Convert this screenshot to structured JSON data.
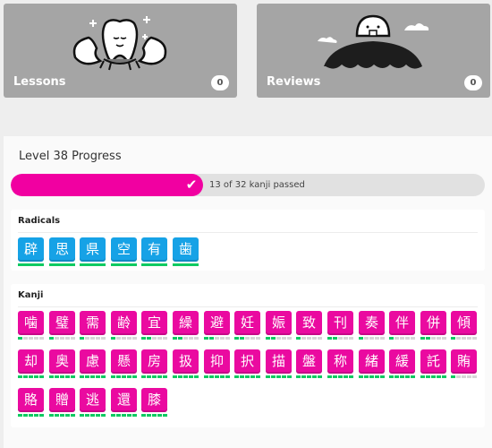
{
  "cards": {
    "lessons": {
      "label": "Lessons",
      "count": "0"
    },
    "reviews": {
      "label": "Reviews",
      "count": "0"
    }
  },
  "progress": {
    "title": "Level 38 Progress",
    "text": "13 of 32 kanji passed",
    "passed": 13,
    "total": 32,
    "fill_fraction": 0.405
  },
  "radicals": {
    "heading": "Radicals",
    "items": [
      "辟",
      "思",
      "県",
      "空",
      "有",
      "歯"
    ]
  },
  "kanji": {
    "heading": "Kanji",
    "items": [
      {
        "char": "噛",
        "stage": 1
      },
      {
        "char": "璧",
        "stage": 1
      },
      {
        "char": "需",
        "stage": 1
      },
      {
        "char": "齢",
        "stage": 1
      },
      {
        "char": "宜",
        "stage": 2
      },
      {
        "char": "繰",
        "stage": 2
      },
      {
        "char": "避",
        "stage": 2
      },
      {
        "char": "妊",
        "stage": 2
      },
      {
        "char": "娠",
        "stage": 2
      },
      {
        "char": "致",
        "stage": 1
      },
      {
        "char": "刊",
        "stage": 2
      },
      {
        "char": "奏",
        "stage": 1
      },
      {
        "char": "伴",
        "stage": 1
      },
      {
        "char": "併",
        "stage": 2
      },
      {
        "char": "傾",
        "stage": 1
      },
      {
        "char": "却",
        "stage": 5
      },
      {
        "char": "奥",
        "stage": 5
      },
      {
        "char": "慮",
        "stage": 5
      },
      {
        "char": "懸",
        "stage": 5
      },
      {
        "char": "房",
        "stage": 5
      },
      {
        "char": "扱",
        "stage": 5
      },
      {
        "char": "抑",
        "stage": 5
      },
      {
        "char": "択",
        "stage": 5
      },
      {
        "char": "描",
        "stage": 5
      },
      {
        "char": "盤",
        "stage": 5
      },
      {
        "char": "称",
        "stage": 5
      },
      {
        "char": "緒",
        "stage": 5
      },
      {
        "char": "緩",
        "stage": 5
      },
      {
        "char": "託",
        "stage": 5
      },
      {
        "char": "賄",
        "stage": 1
      },
      {
        "char": "賂",
        "stage": 5
      },
      {
        "char": "贈",
        "stage": 5
      },
      {
        "char": "逃",
        "stage": 5
      },
      {
        "char": "還",
        "stage": 5
      },
      {
        "char": "膝",
        "stage": 5
      }
    ]
  },
  "colors": {
    "radical": "#16a2e6",
    "kanji": "#ea0aa0",
    "progress_fill": "#f100a1",
    "srs_done": "#0fca61"
  }
}
